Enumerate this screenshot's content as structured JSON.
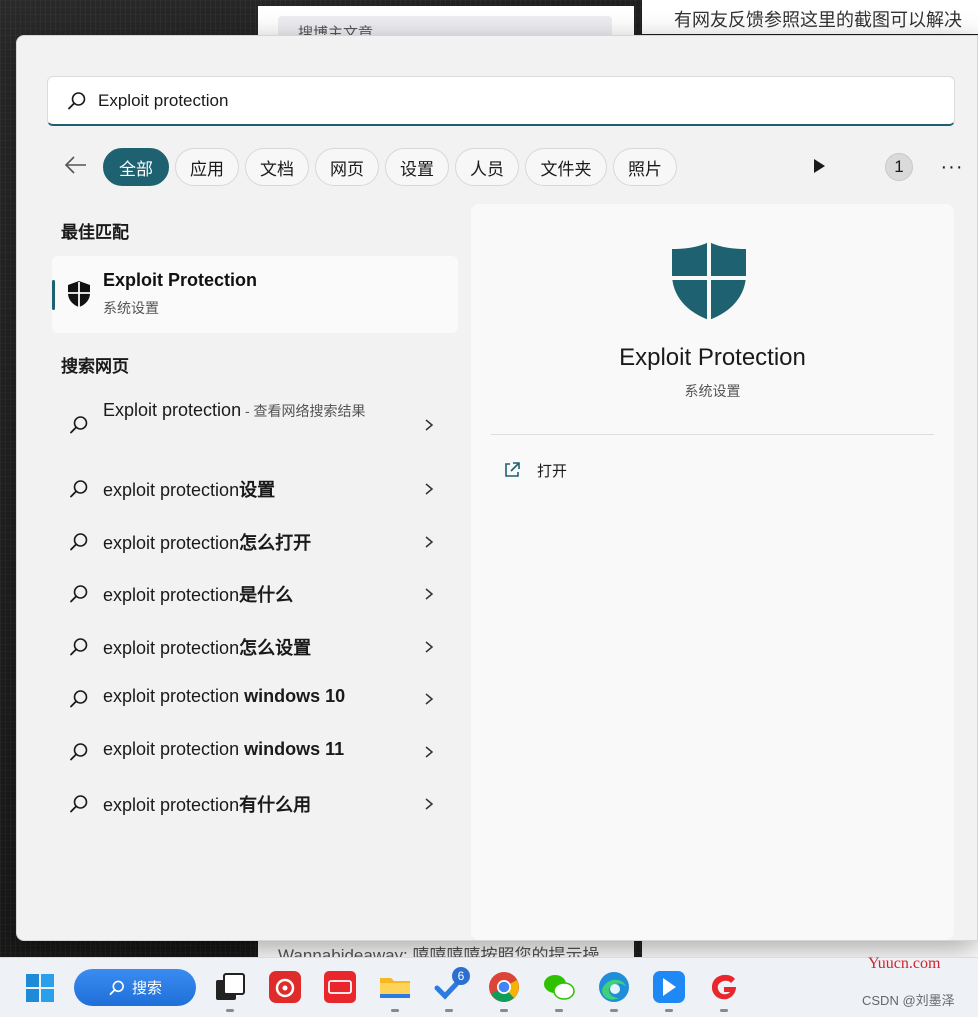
{
  "background": {
    "browser_search_placeholder": "搜博主文章",
    "right_text": "有网友反馈参照这里的截图可以解决",
    "bottom_text": "Wannabideaway: 嘻嘻嘻嘻按照您的提示操"
  },
  "search": {
    "query": "Exploit protection",
    "icon": "search-icon"
  },
  "filters": {
    "tabs": [
      {
        "label": "全部",
        "active": true
      },
      {
        "label": "应用"
      },
      {
        "label": "文档"
      },
      {
        "label": "网页"
      },
      {
        "label": "设置"
      },
      {
        "label": "人员"
      },
      {
        "label": "文件夹"
      },
      {
        "label": "照片"
      }
    ],
    "badge_count": "1",
    "more_label": "···"
  },
  "best_match": {
    "section_title": "最佳匹配",
    "title": "Exploit Protection",
    "subtitle": "系统设置",
    "icon": "shield-icon"
  },
  "web": {
    "section_title": "搜索网页",
    "first": {
      "main": "Exploit protection",
      "sub": " - 查看网络搜索结果"
    },
    "results": [
      {
        "prefix": "exploit protection",
        "bold": "设置"
      },
      {
        "prefix": "exploit protection",
        "bold": "怎么打开"
      },
      {
        "prefix": "exploit protection",
        "bold": "是什么"
      },
      {
        "prefix": "exploit protection",
        "bold": "怎么设置"
      },
      {
        "prefix": "exploit protection ",
        "bold": "windows 10"
      },
      {
        "prefix": "exploit protection ",
        "bold": "windows 11"
      },
      {
        "prefix": "exploit protection",
        "bold": "有什么用"
      }
    ]
  },
  "preview": {
    "title": "Exploit Protection",
    "subtitle": "系统设置",
    "open_label": "打开",
    "accent_color": "#1e6170"
  },
  "taskbar": {
    "search_label": "搜索",
    "todo_badge": "6"
  },
  "watermarks": {
    "site": "Yuucn.com",
    "author": "CSDN @刘墨泽"
  }
}
